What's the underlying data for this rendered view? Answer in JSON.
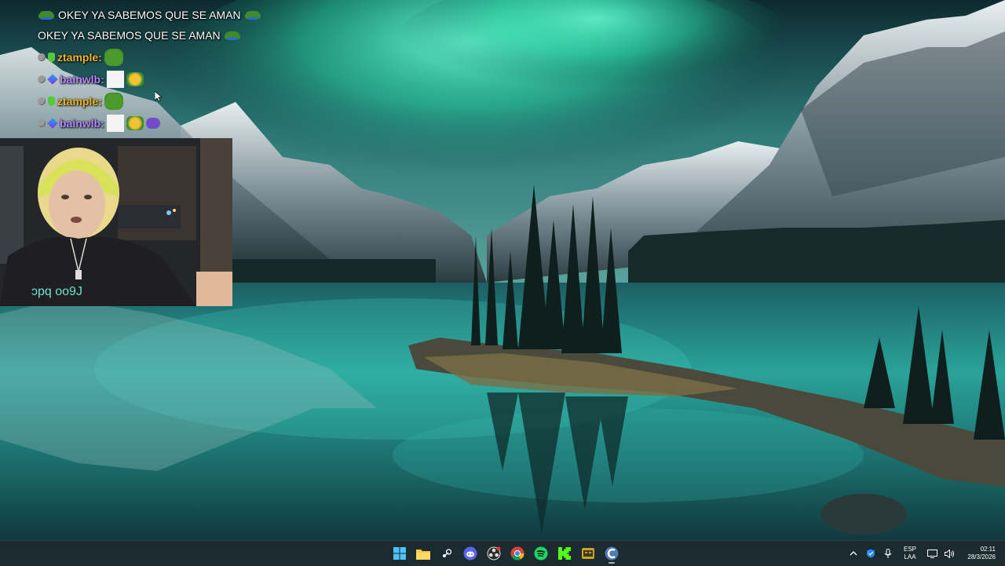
{
  "chat": {
    "messages": [
      {
        "type": "text",
        "text": "OKEY YA SABEMOS QUE SE AMAN",
        "leading_emote": "frog-emote",
        "trailing_emote": "frog-emote"
      },
      {
        "type": "text",
        "text": "OKEY YA SABEMOS QUE SE AMAN",
        "trailing_emote": "frog-emote"
      },
      {
        "type": "user",
        "username": "ztample:",
        "username_color": "#f0b429",
        "badges": [
          "grey-badge",
          "green-badge"
        ],
        "emotes": [
          "frog-emote"
        ]
      },
      {
        "type": "user",
        "username": "bainwlb:",
        "username_color": "#b388ff",
        "badges": [
          "grey-badge",
          "blue-badge"
        ],
        "emotes": [
          "white-emote",
          "gold-emote"
        ]
      },
      {
        "type": "user",
        "username": "ztample:",
        "username_color": "#f0b429",
        "badges": [
          "grey-badge",
          "green-badge"
        ],
        "emotes": [
          "frog-emote"
        ]
      },
      {
        "type": "user",
        "username": "bainwlb:",
        "username_color": "#b388ff",
        "badges": [
          "grey-badge",
          "blue-badge"
        ],
        "emotes": [
          "white-emote",
          "gold-emote",
          "purple-emote"
        ]
      }
    ]
  },
  "taskbar": {
    "apps": [
      {
        "name": "start-button-icon",
        "active": false
      },
      {
        "name": "file-explorer-icon",
        "active": false
      },
      {
        "name": "steam-icon",
        "active": false
      },
      {
        "name": "discord-icon",
        "active": false
      },
      {
        "name": "obs-icon",
        "active": false
      },
      {
        "name": "chrome-icon",
        "active": false
      },
      {
        "name": "spotify-icon",
        "active": false
      },
      {
        "name": "kick-icon",
        "active": false
      },
      {
        "name": "game-app-icon",
        "active": false
      },
      {
        "name": "ccleaner-icon",
        "active": true
      }
    ],
    "tray": {
      "language_line1": "ESP",
      "language_line2": "LAA",
      "time": "02:11",
      "date": "28/3/2026"
    }
  },
  "colors": {
    "aurora": "#3ff0c0",
    "lake": "#1f7f7a",
    "taskbar": "#1c2b30"
  }
}
